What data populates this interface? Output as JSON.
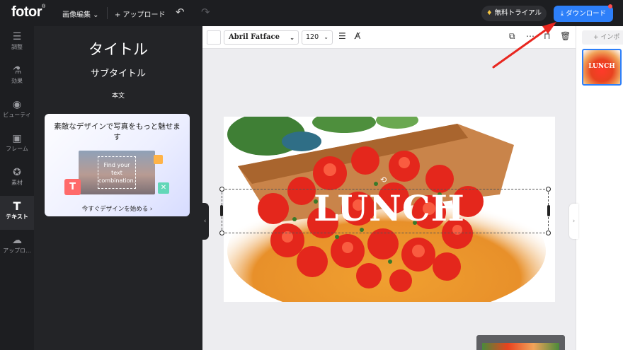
{
  "app": {
    "logo": "fotor",
    "logo_mark": "®",
    "menu_edit": "画像編集 ⌄",
    "upload": "+ アップロード",
    "trial_button": "無料トライアル",
    "download_button": "ダウンロード"
  },
  "left_nav": {
    "items": [
      {
        "label": "調整",
        "icon": "sliders-icon"
      },
      {
        "label": "効果",
        "icon": "flask-icon"
      },
      {
        "label": "ビューティ",
        "icon": "eye-icon"
      },
      {
        "label": "フレーム",
        "icon": "frame-icon"
      },
      {
        "label": "素材",
        "icon": "star-icon"
      },
      {
        "label": "テキスト",
        "icon": "text-icon",
        "active": true
      },
      {
        "label": "アップロ...",
        "icon": "cloud-upload-icon"
      }
    ]
  },
  "text_panel": {
    "title": "タイトル",
    "subtitle": "サブタイトル",
    "body": "本文",
    "promo": {
      "heading": "素敵なデザインで写真をもっと魅せます",
      "sample_text": "Find your text combination.",
      "cta": "今すぐデザインを始める ›"
    }
  },
  "toolbar": {
    "font": "Abril Fatface",
    "font_size": "120"
  },
  "right_panel": {
    "import_label": "+ インポ",
    "thumbnail_text": "LUNCH"
  },
  "canvas": {
    "text": "LUNCH"
  },
  "colors": {
    "topbar": "#1d1e21",
    "panel": "#232427",
    "accent": "#2d7ff9",
    "annotation_arrow": "#e8261f"
  }
}
